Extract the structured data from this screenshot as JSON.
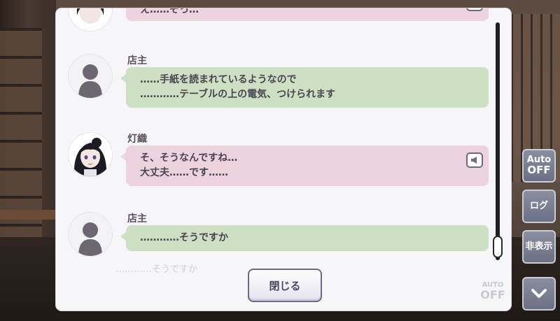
{
  "panel": {
    "entries": [
      {
        "speaker": "",
        "lines": [
          "え……そっ…"
        ],
        "bubble": "pink",
        "voice": true,
        "avatar": "character"
      },
      {
        "speaker": "店主",
        "lines": [
          "……手紙を読まれているようなので",
          "…………テーブルの上の電気、つけられます"
        ],
        "bubble": "green",
        "voice": false,
        "avatar": "silhouette"
      },
      {
        "speaker": "灯織",
        "lines": [
          "そ、そうなんですね…",
          "大丈夫……です……"
        ],
        "bubble": "pink",
        "voice": true,
        "avatar": "character"
      },
      {
        "speaker": "店主",
        "lines": [
          "…………そうですか"
        ],
        "bubble": "green",
        "voice": false,
        "avatar": "silhouette"
      }
    ],
    "close_label": "閉じる",
    "underlying_text": "…………そうですか",
    "underlying_auto_label": "AUTO",
    "underlying_auto_state": "OFF"
  },
  "side_buttons": {
    "auto_label": "Auto",
    "auto_state": "OFF",
    "log_label": "ログ",
    "hide_label": "非表示"
  },
  "colors": {
    "green_bubble": "#cde0c4",
    "pink_bubble": "#ecd3df",
    "panel_bg": "#f6f6f8"
  }
}
